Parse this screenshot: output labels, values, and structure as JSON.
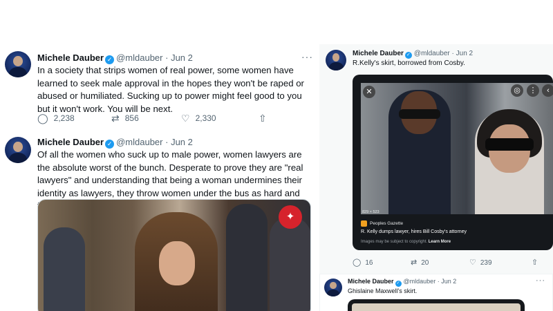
{
  "left_tweets": [
    {
      "name": "Michele Dauber",
      "handle": "@mldauber",
      "date": "Jun 2",
      "text": "In a society that strips women of real power, some women have learned to seek male approval in the hopes they won't be raped or abused or humiliated. Sucking up to power might feel good to you but it won't work. You will be next.",
      "replies": "2,238",
      "retweets": "856",
      "likes": "2,330"
    },
    {
      "name": "Michele Dauber",
      "handle": "@mldauber",
      "date": "Jun 2",
      "text": "Of all the women who suck up to male power, women lawyers are the absolute worst of the bunch. Desperate to prove they are \"real lawyers\" and understanding that being a woman undermines their identity as lawyers, they throw women under the bus as hard and fast as they can."
    }
  ],
  "right_tweets": [
    {
      "name": "Michele Dauber",
      "handle": "@mldauber",
      "date": "Jun 2",
      "text": "R.Kelly's skirt, borrowed from Cosby.",
      "embed": {
        "dimensions": "829 × 523",
        "source": "Peoples Gazette",
        "headline": "R. Kelly dumps lawyer, hires Bill Cosby's attorney",
        "copyright_note": "Images may be subject to copyright.",
        "learn_more": "Learn More"
      },
      "replies": "16",
      "retweets": "20",
      "likes": "239"
    },
    {
      "name": "Michele Dauber",
      "handle": "@mldauber",
      "date": "Jun 2",
      "text": "Ghislaine Maxwell's skirt."
    }
  ],
  "icons": {
    "verified": "✓",
    "more": "···",
    "reply": "◯",
    "retweet": "⇄",
    "like": "♡",
    "share": "⇧",
    "close": "✕",
    "lens": "◎",
    "vert_more": "⋮",
    "back": "‹"
  },
  "colors": {
    "verified_blue": "#1d9bf0",
    "secondary_text": "#536471",
    "primary_text": "#0f1419"
  }
}
